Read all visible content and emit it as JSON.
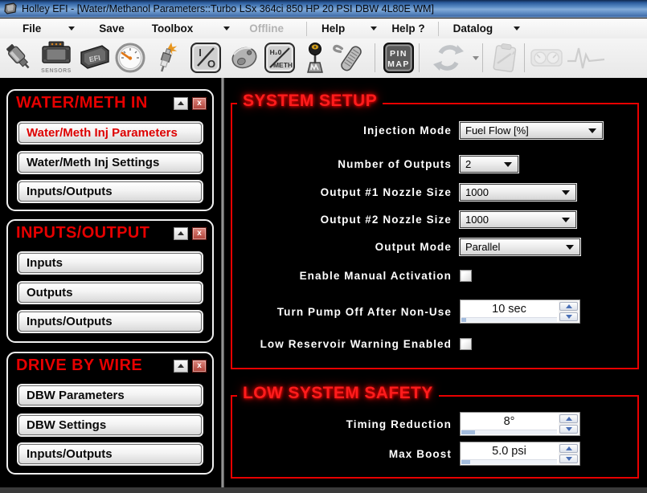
{
  "window": {
    "title": "Holley EFI - [Water/Methanol Parameters::Turbo LSx 364ci 850 HP 20 PSI DBW 4L80E WM]"
  },
  "menubar": {
    "file": "File",
    "save": "Save",
    "toolbox": "Toolbox",
    "offline": "Offline",
    "help": "Help",
    "help_q": "Help ?",
    "datalog": "Datalog"
  },
  "toolbar": {
    "sensors_label": "SENSORS",
    "ecu_label": "EFI",
    "io_i": "I",
    "io_o": "O",
    "wm_top": "H₂0",
    "wm_bottom": "METH",
    "pin": "PIN",
    "map": "MAP"
  },
  "icons": {
    "toolbar": [
      "injector-icon",
      "sensors-icon",
      "ecu-icon",
      "gauge-icon",
      "spark-plug-icon",
      "io-icon",
      "knock-sensor-icon",
      "water-meth-icon",
      "shifter-icon",
      "harness-icon",
      "pin-map-icon",
      "sync-icon",
      "notes-icon",
      "dash-gauges-icon",
      "pulse-icon"
    ],
    "panel": [
      "collapse-up-icon",
      "close-icon"
    ],
    "dropdown_arrow": "chevron-down-icon"
  },
  "sidebar": {
    "close_glyph": "x",
    "panels": [
      {
        "title": "WATER/METH IN",
        "buttons": [
          {
            "label": "Water/Meth Inj Parameters",
            "active": true
          },
          {
            "label": "Water/Meth Inj Settings",
            "active": false
          },
          {
            "label": "Inputs/Outputs",
            "active": false
          }
        ]
      },
      {
        "title": "INPUTS/OUTPUT",
        "buttons": [
          {
            "label": "Inputs",
            "active": false
          },
          {
            "label": "Outputs",
            "active": false
          },
          {
            "label": "Inputs/Outputs",
            "active": false
          }
        ]
      },
      {
        "title": "DRIVE BY WIRE",
        "buttons": [
          {
            "label": "DBW Parameters",
            "active": false
          },
          {
            "label": "DBW Settings",
            "active": false
          },
          {
            "label": "Inputs/Outputs",
            "active": false
          }
        ]
      }
    ]
  },
  "main": {
    "system_setup": {
      "title": "SYSTEM SETUP",
      "injection_mode": {
        "label": "Injection Mode",
        "value": "Fuel Flow [%]"
      },
      "number_of_outputs": {
        "label": "Number of Outputs",
        "value": "2"
      },
      "output1_nozzle": {
        "label": "Output #1 Nozzle Size",
        "value": "1000"
      },
      "output2_nozzle": {
        "label": "Output #2 Nozzle Size",
        "value": "1000"
      },
      "output_mode": {
        "label": "Output Mode",
        "value": "Parallel"
      },
      "enable_manual_activation": {
        "label": "Enable Manual Activation",
        "checked": false
      },
      "pump_off": {
        "label": "Turn Pump Off After Non-Use",
        "value": "10 sec"
      },
      "low_reservoir": {
        "label": "Low Reservoir Warning Enabled",
        "checked": false
      }
    },
    "low_system_safety": {
      "title": "LOW SYSTEM SAFETY",
      "timing_reduction": {
        "label": "Timing Reduction",
        "value": "8°"
      },
      "max_boost": {
        "label": "Max Boost",
        "value": "5.0 psi"
      }
    }
  },
  "colors": {
    "accent_red": "#ff0000",
    "titlebar_blue": "#3a67a4",
    "panel_border": "#efefef",
    "spinner_fill": "#a3bcdd"
  }
}
